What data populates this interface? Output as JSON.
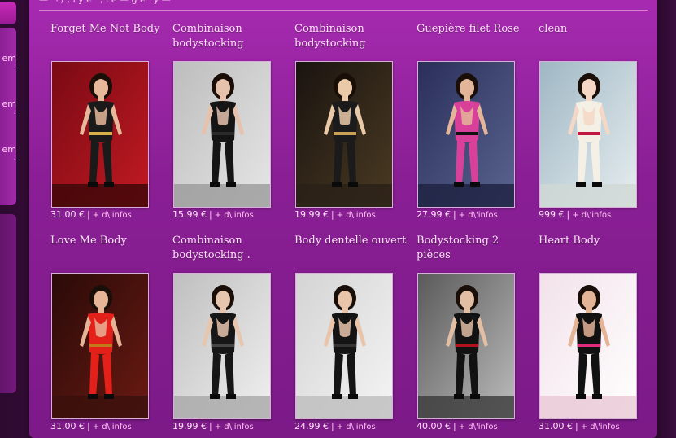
{
  "colors": {
    "panel_top": "#a62ab0",
    "panel_bottom": "#7c1a88",
    "text": "#ffe4f8",
    "link": "#ffc2ef"
  },
  "sidebar": {
    "snippets": [
      {
        "line1": "em",
        "line2": "·"
      },
      {
        "line1": "em",
        "line2": "·"
      },
      {
        "line1": "em",
        "line2": "·"
      }
    ]
  },
  "top_strip": {
    "text": "— ¬ / ; i  y   e   ' ;   i  e  —  g   e   '   y   —  "
  },
  "products": [
    {
      "title": "Forget Me Not Body",
      "price": "31.00 €",
      "info": "+ d\\'infos",
      "scene": "red-curtain"
    },
    {
      "title": "Combinaison bodystocking",
      "price": "15.99 €",
      "info": "+ d\\'infos",
      "scene": "grey-feather"
    },
    {
      "title": "Combinaison bodystocking",
      "price": "19.99 €",
      "info": "+ d\\'infos",
      "scene": "dark-room"
    },
    {
      "title": "Guepière filet Rose",
      "price": "27.99 €",
      "info": "+ d\\'infos",
      "scene": "blue-pink"
    },
    {
      "title": "clean",
      "price": "999 €",
      "info": "+ d\\'infos",
      "scene": "anime"
    },
    {
      "title": "Love Me Body",
      "price": "31.00 €",
      "info": "+ d\\'infos",
      "scene": "red-body"
    },
    {
      "title": "Combinaison bodystocking .",
      "price": "19.99 €",
      "info": "+ d\\'infos",
      "scene": "duo-lace"
    },
    {
      "title": "Body dentelle ouvert",
      "price": "24.99 €",
      "info": "+ d\\'infos",
      "scene": "lace-body"
    },
    {
      "title": "Bodystocking 2 pièces",
      "price": "40.00 €",
      "info": "+ d\\'infos",
      "scene": "two-piece"
    },
    {
      "title": "Heart Body",
      "price": "31.00 €",
      "info": "+ d\\'infos",
      "scene": "heart-pink"
    }
  ]
}
